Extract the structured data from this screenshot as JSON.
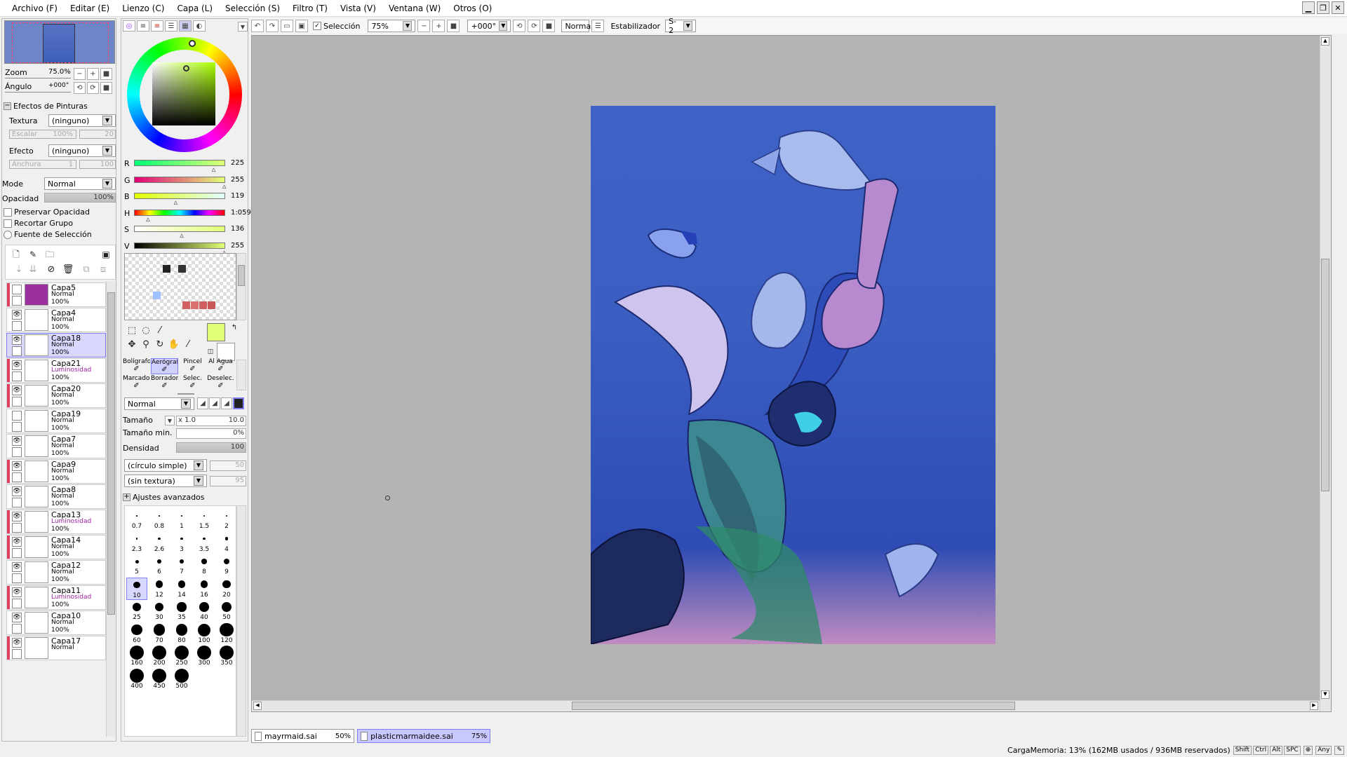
{
  "menu": [
    "Archivo (F)",
    "Editar (E)",
    "Lienzo (C)",
    "Capa (L)",
    "Selección (S)",
    "Filtro (T)",
    "Vista (V)",
    "Ventana (W)",
    "Otros (O)"
  ],
  "window_buttons": [
    "▁",
    "❐",
    "✕"
  ],
  "toolbar": {
    "selection_label": "Selección",
    "zoom_value": "75%",
    "angle_value": "+000°",
    "mode_value": "Normal",
    "stabilizer_label": "Estabilizador",
    "stabilizer_value": "S-2"
  },
  "navigator": {
    "zoom_label": "Zoom",
    "zoom_value": "75.0%",
    "angle_label": "Ángulo",
    "angle_value": "+000°"
  },
  "effects": {
    "header": "Efectos de Pinturas",
    "texture_label": "Textura",
    "texture_value": "(ninguno)",
    "scale_label": "Escalar",
    "scale_value": "100%",
    "scale_num": "20",
    "effect_label": "Efecto",
    "effect_value": "(ninguno)",
    "width_label": "Anchura",
    "width_value": "1",
    "width_num": "100"
  },
  "layer_props": {
    "mode_label": "Mode",
    "mode_value": "Normal",
    "opacity_label": "Opacidad",
    "opacity_value": "100%",
    "preserve_opacity": "Preservar Opacidad",
    "clip_group": "Recortar Grupo",
    "selection_source": "Fuente de Selección"
  },
  "layers": [
    {
      "name": "Capa5",
      "mode": "Normal",
      "opacity": "100%",
      "visible": false,
      "strip": "#e04060",
      "thumb": "#9b2f9b",
      "selected": false
    },
    {
      "name": "Capa4",
      "mode": "Normal",
      "opacity": "100%",
      "visible": true,
      "strip": "",
      "thumb": "#ffffff",
      "selected": false
    },
    {
      "name": "Capa18",
      "mode": "Normal",
      "opacity": "100%",
      "visible": true,
      "strip": "",
      "thumb": "#ffffff",
      "selected": true
    },
    {
      "name": "Capa21",
      "mode": "Luminosidad",
      "opacity": "100%",
      "visible": true,
      "strip": "#e04060",
      "thumb": "#ffffff",
      "selected": false
    },
    {
      "name": "Capa20",
      "mode": "Normal",
      "opacity": "100%",
      "visible": true,
      "strip": "#e04060",
      "thumb": "#ffffff",
      "selected": false
    },
    {
      "name": "Capa19",
      "mode": "Normal",
      "opacity": "100%",
      "visible": false,
      "strip": "",
      "thumb": "#ffffff",
      "selected": false
    },
    {
      "name": "Capa7",
      "mode": "Normal",
      "opacity": "100%",
      "visible": true,
      "strip": "",
      "thumb": "#ffffff",
      "selected": false
    },
    {
      "name": "Capa9",
      "mode": "Normal",
      "opacity": "100%",
      "visible": true,
      "strip": "#e04060",
      "thumb": "#ffffff",
      "selected": false
    },
    {
      "name": "Capa8",
      "mode": "Normal",
      "opacity": "100%",
      "visible": true,
      "strip": "",
      "thumb": "#ffffff",
      "selected": false
    },
    {
      "name": "Capa13",
      "mode": "Luminosidad",
      "opacity": "100%",
      "visible": true,
      "strip": "#e04060",
      "thumb": "#ffffff",
      "selected": false
    },
    {
      "name": "Capa14",
      "mode": "Normal",
      "opacity": "100%",
      "visible": true,
      "strip": "#e04060",
      "thumb": "#ffffff",
      "selected": false
    },
    {
      "name": "Capa12",
      "mode": "Normal",
      "opacity": "100%",
      "visible": true,
      "strip": "",
      "thumb": "#ffffff",
      "selected": false
    },
    {
      "name": "Capa11",
      "mode": "Luminosidad",
      "opacity": "100%",
      "visible": true,
      "strip": "#e04060",
      "thumb": "#ffffff",
      "selected": false
    },
    {
      "name": "Capa10",
      "mode": "Normal",
      "opacity": "100%",
      "visible": true,
      "strip": "",
      "thumb": "#ffffff",
      "selected": false
    },
    {
      "name": "Capa17",
      "mode": "Normal",
      "opacity": "",
      "visible": true,
      "strip": "#e04060",
      "thumb": "#ffffff",
      "selected": false
    }
  ],
  "sliders": [
    {
      "key": "R",
      "value": "225",
      "gradient": "linear-gradient(to right,#00ff77,#e1ff77)"
    },
    {
      "key": "G",
      "value": "255",
      "gradient": "linear-gradient(to right,#e10077,#e1ff77)"
    },
    {
      "key": "B",
      "value": "119",
      "gradient": "linear-gradient(to right,#e1ff00,#e1ffff)"
    },
    {
      "key": "H",
      "value": "1:059",
      "gradient": "linear-gradient(to right,#f00,#ff0,#0f0,#0ff,#00f,#f0f,#f00)"
    },
    {
      "key": "S",
      "value": "136",
      "gradient": "linear-gradient(to right,#ffffff,#e1ff77)"
    },
    {
      "key": "V",
      "value": "255",
      "gradient": "linear-gradient(to right,#000000,#e1ff77)"
    }
  ],
  "colors": {
    "primary": "#e1ff77",
    "secondary": "#ffffff"
  },
  "brush_tools": [
    {
      "label": "Bolígrafo",
      "selected": false
    },
    {
      "label": "Aerógrafo",
      "selected": true
    },
    {
      "label": "Pincel",
      "selected": false
    },
    {
      "label": "Al Agua",
      "selected": false
    },
    {
      "label": "Marcador",
      "selected": false
    },
    {
      "label": "Borrador",
      "selected": false
    },
    {
      "label": "Selec.",
      "selected": false
    },
    {
      "label": "Deselec.",
      "selected": false
    }
  ],
  "brush_settings": {
    "blend_mode": "Normal",
    "size_label": "Tamaño",
    "size_mult": "x 1.0",
    "size_value": "10.0",
    "min_size_label": "Tamaño min.",
    "min_size_value": "0%",
    "density_label": "Densidad",
    "density_value": "100",
    "shape_value": "(círculo simple)",
    "shape_num": "50",
    "texture_value": "(sin textura)",
    "texture_num": "95",
    "advanced": "Ajustes avanzados"
  },
  "brush_sizes": [
    "0.7",
    "0.8",
    "1",
    "1.5",
    "2",
    "2.3",
    "2.6",
    "3",
    "3.5",
    "4",
    "5",
    "6",
    "7",
    "8",
    "9",
    "10",
    "12",
    "14",
    "16",
    "20",
    "25",
    "30",
    "35",
    "40",
    "50",
    "60",
    "70",
    "80",
    "100",
    "120",
    "160",
    "200",
    "250",
    "300",
    "350",
    "400",
    "450",
    "500"
  ],
  "selected_brush_size": "10",
  "tabs": [
    {
      "name": "mayrmaid.sai",
      "pct": "50%",
      "active": false
    },
    {
      "name": "plasticmarmaidee.sai",
      "pct": "75%",
      "active": true
    }
  ],
  "status": {
    "memory": "CargaMemoria: 13% (162MB usados / 936MB reservados)",
    "keys": [
      "Shift",
      "Ctrl",
      "Alt",
      "SPC"
    ],
    "any_label": "Any"
  }
}
